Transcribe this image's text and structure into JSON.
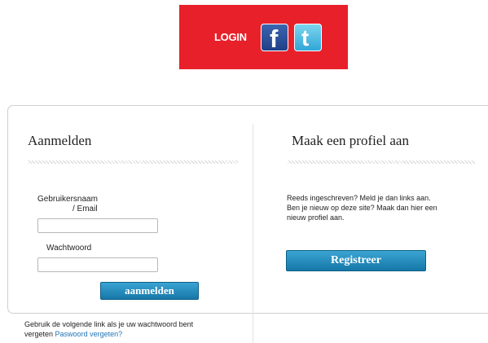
{
  "banner": {
    "login_label": "LOGIN",
    "facebook_glyph": "f",
    "twitter_glyph": "t",
    "background_color": "#e8202a"
  },
  "login_section": {
    "title": "Aanmelden",
    "username_label_line1": "Gebruikersnaam",
    "username_label_line2": "/ Email",
    "username_value": "",
    "password_label": "Wachtwoord",
    "password_value": "",
    "submit_label": "aanmelden"
  },
  "register_section": {
    "title": "Maak een profiel aan",
    "text_line1": "Reeds ingeschreven? Meld je dan links aan.",
    "text_line2": "Ben je nieuw op deze site? Maak dan hier een",
    "text_line3": "nieuw profiel aan.",
    "register_label": "Registreer"
  },
  "forgot": {
    "text_line1": "Gebruik de volgende link als je uw wachtwoord bent",
    "text_line2_prefix": "vergeten",
    "link_label": "Paswoord vergeten?"
  },
  "colors": {
    "accent_blue": "#1577a8",
    "link_blue": "#1f73b7"
  }
}
